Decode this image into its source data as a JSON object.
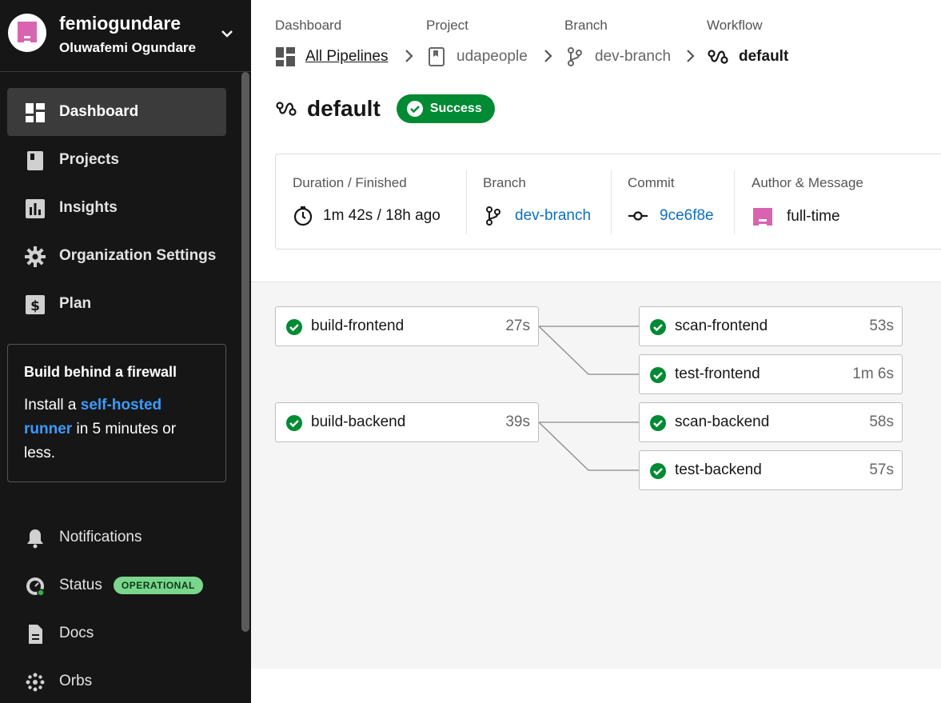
{
  "org": {
    "name": "femiogundare",
    "user": "Oluwafemi Ogundare"
  },
  "nav": [
    {
      "label": "Dashboard",
      "icon": "dashboard-icon",
      "active": true
    },
    {
      "label": "Projects",
      "icon": "projects-icon"
    },
    {
      "label": "Insights",
      "icon": "insights-icon"
    },
    {
      "label": "Organization Settings",
      "icon": "gear-icon"
    },
    {
      "label": "Plan",
      "icon": "dollar-icon"
    }
  ],
  "promo": {
    "title": "Build behind a firewall",
    "pre": "Install a ",
    "link": "self-hosted runner",
    "post": " in 5 minutes or less."
  },
  "nav_bottom": [
    {
      "label": "Notifications",
      "icon": "bell-icon"
    },
    {
      "label": "Status",
      "icon": "status-gauge-icon",
      "badge": "OPERATIONAL"
    },
    {
      "label": "Docs",
      "icon": "docs-icon"
    },
    {
      "label": "Orbs",
      "icon": "orbs-icon"
    }
  ],
  "breadcrumb": [
    {
      "label": "Dashboard",
      "value": "All Pipelines",
      "icon": "pipelines-icon"
    },
    {
      "label": "Project",
      "value": "udapeople",
      "icon": "project-bookmark-icon"
    },
    {
      "label": "Branch",
      "value": "dev-branch",
      "icon": "branch-icon"
    },
    {
      "label": "Workflow",
      "value": "default",
      "icon": "workflow-icon"
    }
  ],
  "workflow": {
    "name": "default",
    "status": "Success",
    "status_color": "#008a33"
  },
  "details": {
    "duration_label": "Duration / Finished",
    "duration_value": "1m 42s / 18h ago",
    "branch_label": "Branch",
    "branch_value": "dev-branch",
    "commit_label": "Commit",
    "commit_value": "9ce6f8e",
    "author_label": "Author & Message",
    "author_value": "full-time"
  },
  "jobs": [
    {
      "name": "build-frontend",
      "duration": "27s"
    },
    {
      "name": "scan-frontend",
      "duration": "53s"
    },
    {
      "name": "test-frontend",
      "duration": "1m 6s"
    },
    {
      "name": "build-backend",
      "duration": "39s"
    },
    {
      "name": "scan-backend",
      "duration": "58s"
    },
    {
      "name": "test-backend",
      "duration": "57s"
    }
  ],
  "colors": {
    "link": "#0e6fc1",
    "success": "#008a33",
    "accent_link": "#3b9bff",
    "avatar": "#d863b0"
  }
}
